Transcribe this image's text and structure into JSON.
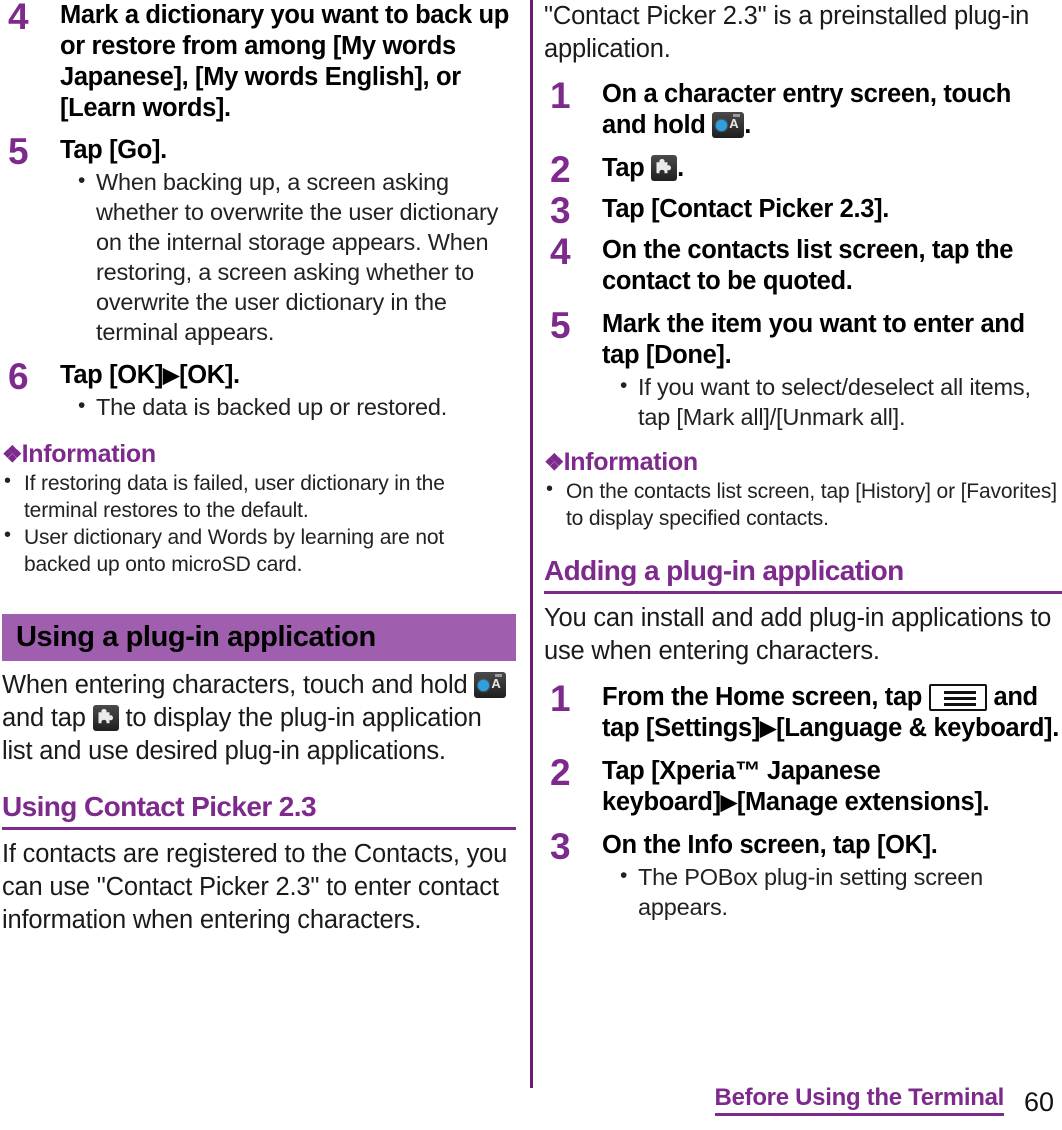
{
  "page": {
    "number": "60",
    "chapter": "Before Using the Terminal"
  },
  "left_column": {
    "steps": [
      {
        "num": "4",
        "title": "Mark a dictionary you want to back up or restore from among [My words Japanese], [My words English], or [Learn words].",
        "bullets": []
      },
      {
        "num": "5",
        "title": "Tap [Go].",
        "bullets": [
          "When backing up, a screen asking whether to overwrite the user dictionary on the internal storage appears. When restoring, a screen asking whether to overwrite the user dictionary in the terminal appears."
        ]
      },
      {
        "num": "6",
        "title_pre": "Tap [OK]",
        "title_post": "[OK].",
        "bullets": [
          "The data is backed up or restored."
        ]
      }
    ],
    "information": {
      "heading": "Information",
      "diamond": "❖",
      "items": [
        "If restoring data is failed, user dictionary in the terminal restores to the default.",
        "User dictionary and Words by learning are not backed up onto microSD card."
      ]
    },
    "banner_heading": "Using a plug-in application",
    "plugin_para": {
      "part1": "When entering characters, touch and hold",
      "part2": "and tap",
      "part3": "to display the plug-in application list and use desired plug-in applications."
    },
    "contact_picker_heading": "Using Contact Picker 2.3",
    "contact_picker_para": "If contacts are registered to the Contacts, you can use \"Contact Picker 2.3\" to enter contact information when entering characters."
  },
  "right_column": {
    "intro_para": "\"Contact Picker 2.3\" is a preinstalled plug-in application.",
    "steps": [
      {
        "num": "1",
        "title_pre": "On a character entry screen, touch and hold",
        "title_post": ".",
        "bullets": []
      },
      {
        "num": "2",
        "title_pre": "Tap",
        "title_post": ".",
        "bullets": []
      },
      {
        "num": "3",
        "title": "Tap [Contact Picker 2.3].",
        "bullets": []
      },
      {
        "num": "4",
        "title": "On the contacts list screen, tap the contact to be quoted.",
        "bullets": []
      },
      {
        "num": "5",
        "title": "Mark the item you want to enter and tap [Done].",
        "bullets": [
          "If you want to select/deselect all items, tap [Mark all]/[Unmark all]."
        ]
      }
    ],
    "information": {
      "heading": "Information",
      "diamond": "❖",
      "items": [
        "On the contacts list screen, tap [History] or [Favorites] to display specified contacts."
      ]
    },
    "adding_heading": "Adding a plug-in application",
    "adding_para": "You can install and add plug-in applications to use when entering characters.",
    "adding_steps": [
      {
        "num": "1",
        "title_pre": "From the Home screen, tap",
        "title_mid": "and tap [Settings]",
        "title_post": "[Language & keyboard].",
        "bullets": []
      },
      {
        "num": "2",
        "title_pre": "Tap [Xperia™ Japanese keyboard]",
        "title_post": "[Manage extensions].",
        "bullets": []
      },
      {
        "num": "3",
        "title": "On the Info screen, tap [OK].",
        "bullets": [
          "The POBox plug-in setting screen appears."
        ]
      }
    ]
  },
  "symbols": {
    "arrow": "▶",
    "bullet": "•"
  },
  "colors": {
    "accent_purple": "#7d2a8c",
    "banner_purple": "#a05fae",
    "divider_purple": "#6d1d6d",
    "text": "#1a1a1a"
  },
  "icons": {
    "ime_switch": "input-method-switch-icon",
    "plugin_puzzle": "puzzle-plugin-icon",
    "menu_key": "menu-key-icon"
  }
}
